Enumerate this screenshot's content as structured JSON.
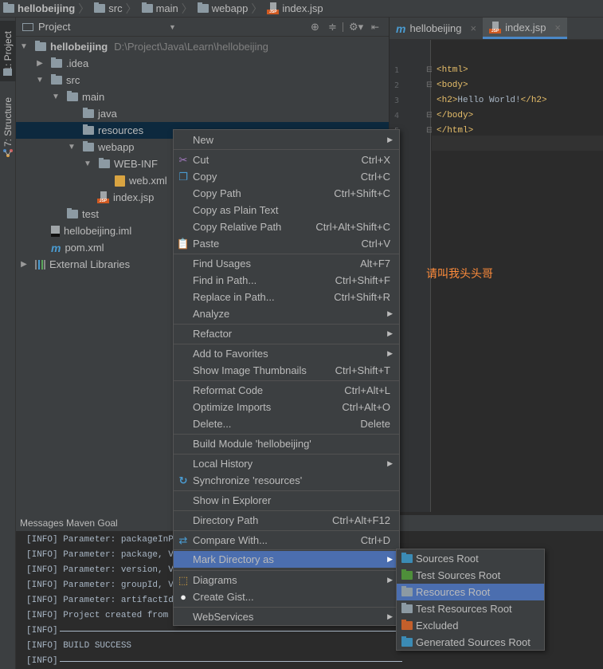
{
  "navbar": {
    "crumbs": [
      "hellobeijing",
      "src",
      "main",
      "webapp",
      "index.jsp"
    ]
  },
  "left_tabs": {
    "project": "1: Project",
    "structure": "7: Structure"
  },
  "project_panel": {
    "title": "Project",
    "tree": [
      {
        "label": "hellobeijing",
        "path": "D:\\Project\\Java\\Learn\\hellobeijing",
        "icon": "module-folder-icon",
        "expanded": true
      },
      {
        "label": ".idea",
        "icon": "folder-icon",
        "expanded": false
      },
      {
        "label": "src",
        "icon": "folder-icon",
        "expanded": true
      },
      {
        "label": "main",
        "icon": "folder-icon",
        "expanded": true
      },
      {
        "label": "java",
        "icon": "folder-icon"
      },
      {
        "label": "resources",
        "icon": "folder-icon",
        "selected": true
      },
      {
        "label": "webapp",
        "icon": "folder-icon",
        "expanded": true
      },
      {
        "label": "WEB-INF",
        "icon": "folder-icon",
        "expanded": true
      },
      {
        "label": "web.xml",
        "icon": "xml-file-icon"
      },
      {
        "label": "index.jsp",
        "icon": "jsp-file-icon"
      },
      {
        "label": "test",
        "icon": "folder-icon"
      },
      {
        "label": "hellobeijing.iml",
        "icon": "iml-file-icon"
      },
      {
        "label": "pom.xml",
        "icon": "maven-icon"
      },
      {
        "label": "External Libraries",
        "icon": "libraries-icon",
        "expanded": false
      }
    ]
  },
  "editor": {
    "tabs": [
      {
        "label": "hellobeijing",
        "icon": "maven-icon",
        "active": false
      },
      {
        "label": "index.jsp",
        "icon": "jsp-file-icon",
        "active": true
      }
    ],
    "line_numbers": [
      "1",
      "2",
      "3",
      "4",
      "5"
    ],
    "lines": [
      {
        "tag": "<html>",
        "text": ""
      },
      {
        "tag": "<body>",
        "text": ""
      },
      {
        "tag": "<h2>",
        "text": "Hello World!",
        "close": "</h2>"
      },
      {
        "tag": "</body>",
        "text": ""
      },
      {
        "tag": "</html>",
        "text": ""
      }
    ],
    "annotation": "请叫我头头哥"
  },
  "messages": {
    "title": "Messages Maven Goal",
    "lines": [
      "[INFO] Parameter: packageInPath",
      "[INFO] Parameter: package, Valu",
      "[INFO] Parameter: version, Valu",
      "[INFO] Parameter: groupId, Valu",
      "[INFO] Parameter: artifactId, V",
      "[INFO] Project created from Arc",
      "[INFO]",
      "[INFO] BUILD SUCCESS",
      "[INFO]"
    ]
  },
  "context_menu": {
    "items": [
      {
        "label": "New",
        "shortcut": "",
        "submenu": true
      },
      {
        "label": "Cut",
        "shortcut": "Ctrl+X",
        "icon": "scissors-icon"
      },
      {
        "label": "Copy",
        "shortcut": "Ctrl+C",
        "icon": "copy-icon"
      },
      {
        "label": "Copy Path",
        "shortcut": "Ctrl+Shift+C"
      },
      {
        "label": "Copy as Plain Text",
        "shortcut": ""
      },
      {
        "label": "Copy Relative Path",
        "shortcut": "Ctrl+Alt+Shift+C"
      },
      {
        "label": "Paste",
        "shortcut": "Ctrl+V",
        "icon": "paste-icon"
      },
      {
        "label": "Find Usages",
        "shortcut": "Alt+F7"
      },
      {
        "label": "Find in Path...",
        "shortcut": "Ctrl+Shift+F"
      },
      {
        "label": "Replace in Path...",
        "shortcut": "Ctrl+Shift+R"
      },
      {
        "label": "Analyze",
        "shortcut": "",
        "submenu": true
      },
      {
        "label": "Refactor",
        "shortcut": "",
        "submenu": true
      },
      {
        "label": "Add to Favorites",
        "shortcut": "",
        "submenu": true
      },
      {
        "label": "Show Image Thumbnails",
        "shortcut": "Ctrl+Shift+T"
      },
      {
        "label": "Reformat Code",
        "shortcut": "Ctrl+Alt+L"
      },
      {
        "label": "Optimize Imports",
        "shortcut": "Ctrl+Alt+O"
      },
      {
        "label": "Delete...",
        "shortcut": "Delete"
      },
      {
        "label": "Build Module 'hellobeijing'",
        "shortcut": ""
      },
      {
        "label": "Local History",
        "shortcut": "",
        "submenu": true
      },
      {
        "label": "Synchronize 'resources'",
        "shortcut": "",
        "icon": "sync-icon"
      },
      {
        "label": "Show in Explorer",
        "shortcut": ""
      },
      {
        "label": "Directory Path",
        "shortcut": "Ctrl+Alt+F12"
      },
      {
        "label": "Compare With...",
        "shortcut": "Ctrl+D",
        "icon": "compare-icon"
      },
      {
        "label": "Mark Directory as",
        "shortcut": "",
        "submenu": true,
        "highlighted": true
      },
      {
        "label": "Diagrams",
        "shortcut": "",
        "submenu": true,
        "icon": "diagram-icon"
      },
      {
        "label": "Create Gist...",
        "shortcut": "",
        "icon": "github-icon"
      },
      {
        "label": "WebServices",
        "shortcut": "",
        "submenu": true
      }
    ]
  },
  "submenu": {
    "items": [
      {
        "label": "Sources Root",
        "color": "#3b8bb5"
      },
      {
        "label": "Test Sources Root",
        "color": "#4e8f3a"
      },
      {
        "label": "Resources Root",
        "color": "#8c9aa3",
        "highlighted": true
      },
      {
        "label": "Test Resources Root",
        "color": "#8c9aa3"
      },
      {
        "label": "Excluded",
        "color": "#c35f2b"
      },
      {
        "label": "Generated Sources Root",
        "color": "#3b8bb5"
      }
    ]
  },
  "colors": {
    "selection": "#0d293e",
    "menu_highlight": "#4b6eaf",
    "annotation": "#ff8c3b",
    "tag": "#e8bf6a"
  }
}
